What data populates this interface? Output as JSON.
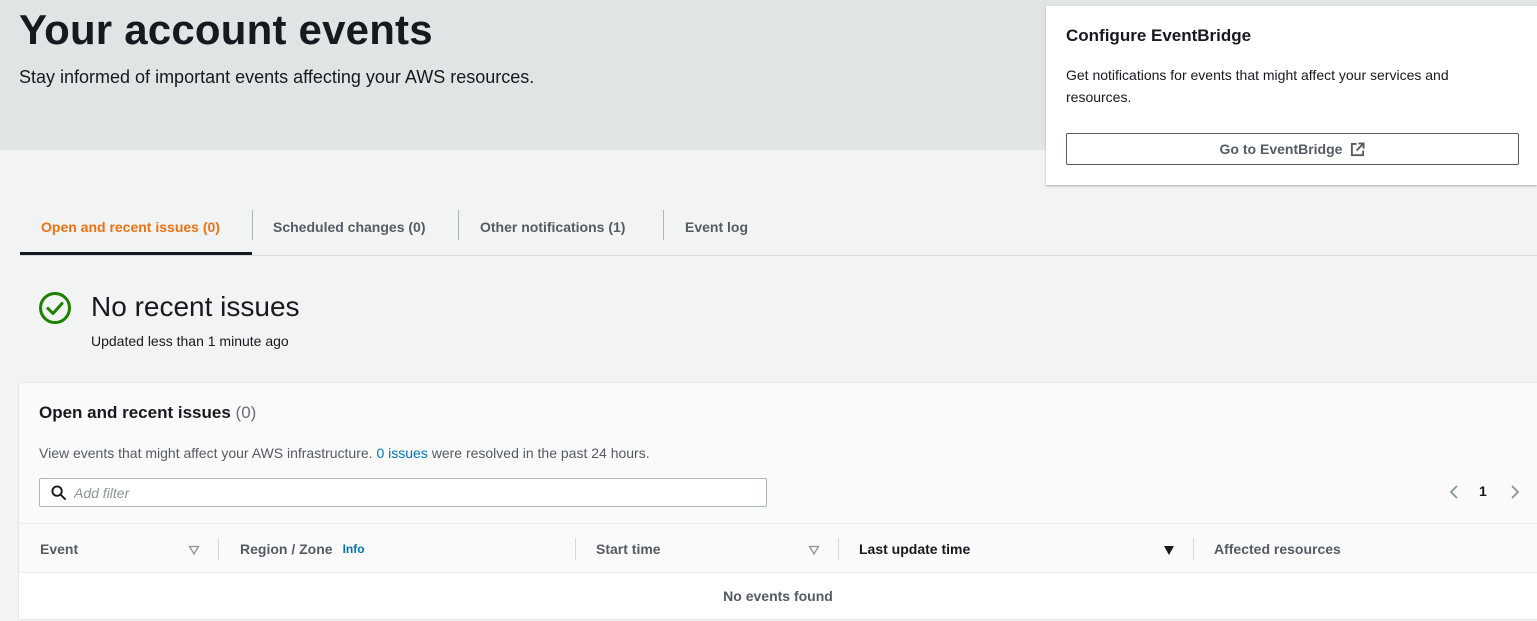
{
  "header": {
    "title": "Your account events",
    "subtitle": "Stay informed of important events affecting your AWS resources."
  },
  "eventbridge": {
    "title": "Configure EventBridge",
    "description": "Get notifications for events that might affect your services and resources.",
    "button_label": "Go to EventBridge",
    "button_icon": "external-link-icon"
  },
  "tabs": [
    {
      "label": "Open and recent issues (0)",
      "active": true
    },
    {
      "label": "Scheduled changes (0)",
      "active": false
    },
    {
      "label": "Other notifications (1)",
      "active": false
    },
    {
      "label": "Event log",
      "active": false
    }
  ],
  "status": {
    "icon": "check-circle-icon",
    "title": "No recent issues",
    "updated": "Updated less than 1 minute ago"
  },
  "issues_table": {
    "title": "Open and recent issues",
    "count": "(0)",
    "description_prefix": "View events that might affect your AWS infrastructure.",
    "description_link": "0 issues",
    "description_suffix": "were resolved in the past 24 hours.",
    "filter_placeholder": "Add filter",
    "page_number": "1",
    "columns": [
      {
        "label": "Event",
        "sort": "unsorted"
      },
      {
        "label": "Region / Zone",
        "info": "Info"
      },
      {
        "label": "Start time",
        "sort": "unsorted"
      },
      {
        "label": "Last update time",
        "sort": "descending"
      },
      {
        "label": "Affected resources"
      }
    ],
    "empty_message": "No events found"
  },
  "colors": {
    "accent_orange": "#ec7211",
    "link_blue": "#0073bb",
    "success_green": "#1d8102",
    "hero_bg": "#e1e4e5",
    "page_bg": "#f2f3f3"
  }
}
